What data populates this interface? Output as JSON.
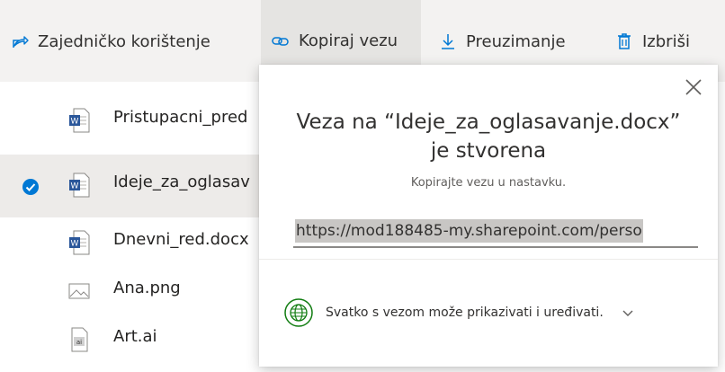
{
  "toolbar": {
    "share_label": "Zajedničko korištenje",
    "copy_link_label": "Kopiraj vezu",
    "download_label": "Preuzimanje",
    "delete_label": "Izbriši"
  },
  "files": [
    {
      "name": "Pristupacni_pred",
      "icon": "word-doc-icon",
      "selected": false
    },
    {
      "name": "Ideje_za_oglasav",
      "icon": "word-doc-icon",
      "selected": true
    },
    {
      "name": "Dnevni_red.docx",
      "icon": "word-doc-icon",
      "selected": false
    },
    {
      "name": "Ana.png",
      "icon": "image-file-icon",
      "selected": false
    },
    {
      "name": "Art.ai",
      "icon": "illustrator-file-icon",
      "selected": false
    }
  ],
  "dialog": {
    "title_line1": "Veza na “Ideje_za_oglasavanje.docx”",
    "title_line2": "je stvorena",
    "subtitle": "Kopirajte vezu u nastavku.",
    "link_value": "https://mod188485-my.sharepoint.com/perso",
    "permission_text": "Svatko s vezom može prikazivati i uređivati."
  },
  "colors": {
    "accent": "#0078d4",
    "toolbar_bg": "#f3f2f1",
    "selected_row_bg": "#edebe9",
    "permission_green": "#107c10"
  }
}
